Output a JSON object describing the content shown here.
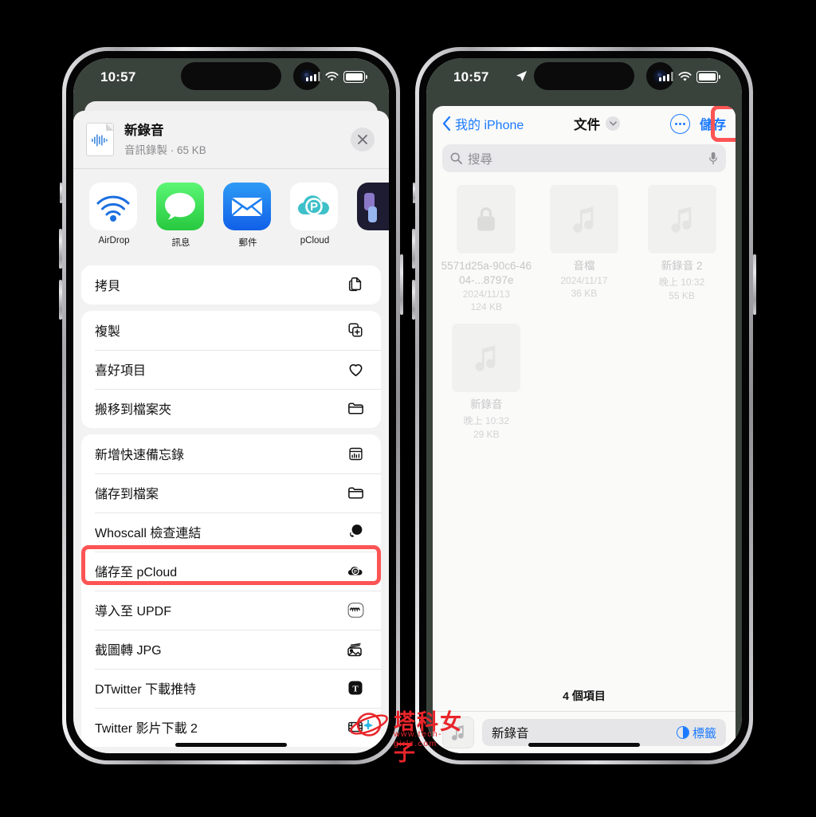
{
  "status_bar": {
    "time": "10:57",
    "location_icon": "location-arrow-icon",
    "signal_icon": "cellular-signal-icon",
    "wifi_icon": "wifi-icon",
    "battery_icon": "battery-icon"
  },
  "left_phone": {
    "share_sheet": {
      "file": {
        "name": "新錄音",
        "subtitle": "音訊錄製 · 65 KB",
        "thumb_icon": "audio-waveform-file-icon"
      },
      "close_label": "×",
      "apps": [
        {
          "label": "AirDrop",
          "icon": "airdrop-icon"
        },
        {
          "label": "訊息",
          "icon": "messages-icon"
        },
        {
          "label": "郵件",
          "icon": "mail-icon"
        },
        {
          "label": "pCloud",
          "icon": "pcloud-icon"
        },
        {
          "label": "",
          "icon": "partial-app-icon"
        }
      ],
      "groups": [
        {
          "rows": [
            {
              "label": "拷貝",
              "icon": "copy-icon"
            }
          ]
        },
        {
          "rows": [
            {
              "label": "複製",
              "icon": "duplicate-icon"
            },
            {
              "label": "喜好項目",
              "icon": "heart-icon"
            },
            {
              "label": "搬移到檔案夾",
              "icon": "folder-icon"
            }
          ]
        },
        {
          "rows": [
            {
              "label": "新增快速備忘錄",
              "icon": "quick-note-icon"
            },
            {
              "label": "儲存到檔案",
              "icon": "folder-icon",
              "highlighted": true
            },
            {
              "label": "Whoscall 檢查連結",
              "icon": "whoscall-icon"
            },
            {
              "label": "儲存至 pCloud",
              "icon": "pcloud-mono-icon"
            },
            {
              "label": "導入至 UPDF",
              "icon": "updf-icon"
            },
            {
              "label": "截圖轉 JPG",
              "icon": "photos-stack-icon"
            },
            {
              "label": "DTwitter 下載推特",
              "icon": "dtwitter-icon"
            },
            {
              "label": "Twitter 影片下載 2",
              "icon": "film-icon"
            }
          ]
        }
      ]
    }
  },
  "right_phone": {
    "files_picker": {
      "back_label": "我的 iPhone",
      "title": "文件",
      "title_chevron_icon": "chevron-down-icon",
      "more_icon": "ellipsis-circle-icon",
      "save_label": "儲存",
      "search": {
        "placeholder": "搜尋",
        "icon": "search-icon",
        "mic_icon": "microphone-icon"
      },
      "items": [
        {
          "name": "5571d25a-90c6-4604-...8797e",
          "date": "2024/11/13",
          "size": "124 KB",
          "icon": "lock-icon"
        },
        {
          "name": "音檔",
          "date": "2024/11/17",
          "size": "36 KB",
          "icon": "music-note-icon"
        },
        {
          "name": "新錄音 2",
          "date": "晚上 10:32",
          "size": "55 KB",
          "icon": "music-note-icon"
        },
        {
          "name": "新錄音",
          "date": "晚上 10:32",
          "size": "29 KB",
          "icon": "music-note-icon"
        }
      ],
      "count_label": "4 個項目",
      "bottom_bar": {
        "thumb_icon": "music-note-icon",
        "filename": "新錄音",
        "tag_label": "標籤",
        "tag_icon": "tag-circle-icon"
      }
    }
  },
  "watermark": {
    "text": "塔科女子",
    "url": "www.tech-girlz.com",
    "logo_icon": "planet-logo-icon",
    "color": "#e8252a"
  },
  "colors": {
    "highlight": "#fc5454",
    "accent_blue": "#1a7aff",
    "status_bg": "#3a423c"
  }
}
